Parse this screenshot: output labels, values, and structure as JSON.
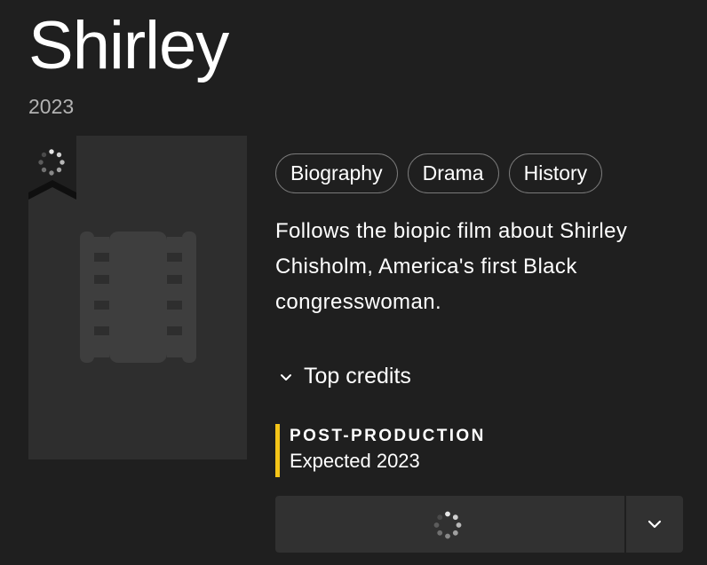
{
  "title": "Shirley",
  "year": "2023",
  "genres": [
    "Biography",
    "Drama",
    "History"
  ],
  "plot": "Follows the biopic film about Shirley Chisholm, America's first Black congresswoman.",
  "credits_toggle": {
    "label": "Top credits",
    "icon": "chevron-down-icon"
  },
  "production_status": {
    "label": "POST-PRODUCTION",
    "detail": "Expected 2023",
    "accent_color": "#f5c518"
  },
  "icons": {
    "poster_placeholder": "film-reel-icon",
    "watchlist": "loading-spinner-icon",
    "action_loading": "loading-spinner-icon",
    "action_more": "chevron-down-icon"
  },
  "colors": {
    "background": "#1f1f1f",
    "poster_bg": "#2e2e2e",
    "button_bg": "#313131",
    "accent": "#f5c518"
  }
}
